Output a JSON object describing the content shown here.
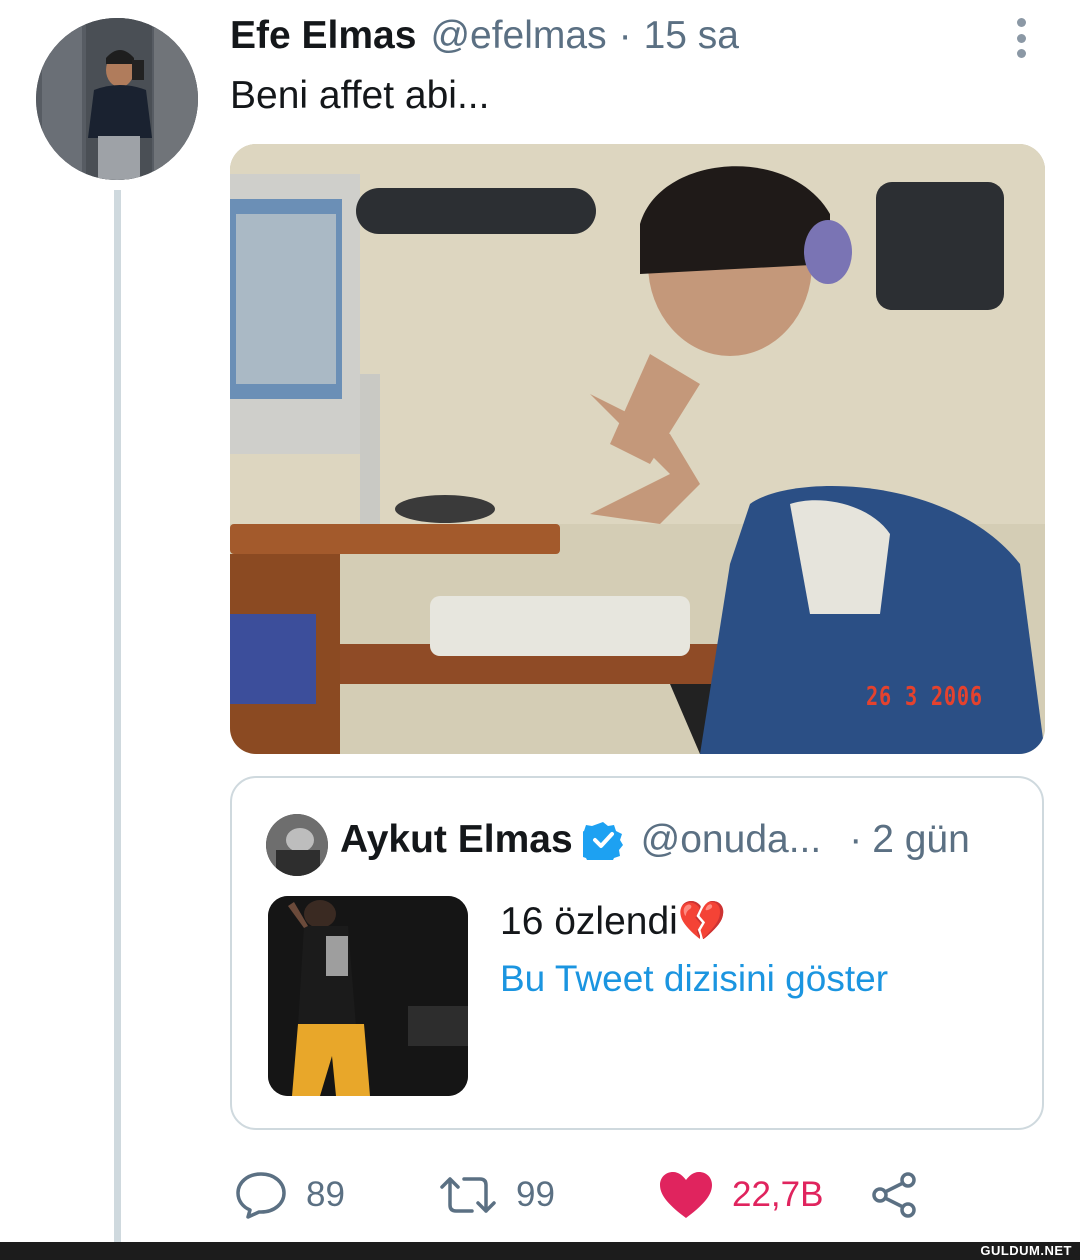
{
  "tweet": {
    "author_name": "Efe Elmas",
    "author_handle": "@efelmas",
    "separator": "·",
    "time": "15 sa",
    "text": "Beni affet abi...",
    "photo_date_stamp": "26  3 2006"
  },
  "quoted_tweet": {
    "author_name": "Aykut Elmas",
    "author_handle": "@onuda...",
    "separator": "·",
    "time": "2 gün",
    "text": "16 özlendi💔",
    "show_thread_label": "Bu Tweet dizisini göster"
  },
  "actions": {
    "reply_count": "89",
    "retweet_count": "99",
    "like_count": "22,7B"
  },
  "colors": {
    "secondary_text": "#5b7083",
    "link": "#1b95e0",
    "like": "#e0245e",
    "verified": "#1da1f2"
  },
  "watermark": "GULDUM.NET"
}
